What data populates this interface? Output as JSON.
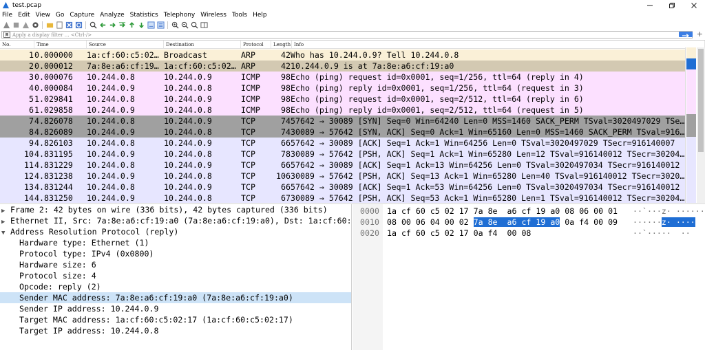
{
  "window": {
    "title": "test.pcap"
  },
  "menu": [
    "File",
    "Edit",
    "View",
    "Go",
    "Capture",
    "Analyze",
    "Statistics",
    "Telephony",
    "Wireless",
    "Tools",
    "Help"
  ],
  "filter": {
    "placeholder": "Apply a display filter … <Ctrl-/>"
  },
  "columns": [
    "No.",
    "Time",
    "Source",
    "Destination",
    "Protocol",
    "Length",
    "Info"
  ],
  "row_colors": {
    "arp": "#faf0d7",
    "icmp": "#fce0ff",
    "tcp_syn": "#a0a0a0",
    "tcp": "#e7e6ff",
    "selected": "#d3c9b2"
  },
  "packets": [
    {
      "no": "1",
      "time": "0.000000",
      "src": "1a:cf:60:c5:02…",
      "dst": "Broadcast",
      "proto": "ARP",
      "len": "42",
      "info": "Who has 10.244.0.9? Tell 10.244.0.8",
      "color": "arp"
    },
    {
      "no": "2",
      "time": "0.000012",
      "src": "7a:8e:a6:cf:19…",
      "dst": "1a:cf:60:c5:02…",
      "proto": "ARP",
      "len": "42",
      "info": "10.244.0.9 is at 7a:8e:a6:cf:19:a0",
      "color": "selected"
    },
    {
      "no": "3",
      "time": "0.000076",
      "src": "10.244.0.8",
      "dst": "10.244.0.9",
      "proto": "ICMP",
      "len": "98",
      "info": "Echo (ping) request  id=0x0001, seq=1/256, ttl=64 (reply in 4)",
      "color": "icmp"
    },
    {
      "no": "4",
      "time": "0.000084",
      "src": "10.244.0.9",
      "dst": "10.244.0.8",
      "proto": "ICMP",
      "len": "98",
      "info": "Echo (ping) reply    id=0x0001, seq=1/256, ttl=64 (request in 3)",
      "color": "icmp"
    },
    {
      "no": "5",
      "time": "1.029841",
      "src": "10.244.0.8",
      "dst": "10.244.0.9",
      "proto": "ICMP",
      "len": "98",
      "info": "Echo (ping) request  id=0x0001, seq=2/512, ttl=64 (reply in 6)",
      "color": "icmp"
    },
    {
      "no": "6",
      "time": "1.029858",
      "src": "10.244.0.9",
      "dst": "10.244.0.8",
      "proto": "ICMP",
      "len": "98",
      "info": "Echo (ping) reply    id=0x0001, seq=2/512, ttl=64 (request in 5)",
      "color": "icmp"
    },
    {
      "no": "7",
      "time": "4.826078",
      "src": "10.244.0.8",
      "dst": "10.244.0.9",
      "proto": "TCP",
      "len": "74",
      "info": "57642 → 30089 [SYN] Seq=0 Win=64240 Len=0 MSS=1460 SACK_PERM TSval=3020497029 TSe…",
      "color": "tcp_syn"
    },
    {
      "no": "8",
      "time": "4.826089",
      "src": "10.244.0.9",
      "dst": "10.244.0.8",
      "proto": "TCP",
      "len": "74",
      "info": "30089 → 57642 [SYN, ACK] Seq=0 Ack=1 Win=65160 Len=0 MSS=1460 SACK_PERM TSval=916…",
      "color": "tcp_syn"
    },
    {
      "no": "9",
      "time": "4.826103",
      "src": "10.244.0.8",
      "dst": "10.244.0.9",
      "proto": "TCP",
      "len": "66",
      "info": "57642 → 30089 [ACK] Seq=1 Ack=1 Win=64256 Len=0 TSval=3020497029 TSecr=916140007",
      "color": "tcp"
    },
    {
      "no": "10",
      "time": "4.831195",
      "src": "10.244.0.9",
      "dst": "10.244.0.8",
      "proto": "TCP",
      "len": "78",
      "info": "30089 → 57642 [PSH, ACK] Seq=1 Ack=1 Win=65280 Len=12 TSval=916140012 TSecr=30204…",
      "color": "tcp"
    },
    {
      "no": "11",
      "time": "4.831229",
      "src": "10.244.0.8",
      "dst": "10.244.0.9",
      "proto": "TCP",
      "len": "66",
      "info": "57642 → 30089 [ACK] Seq=1 Ack=13 Win=64256 Len=0 TSval=3020497034 TSecr=916140012",
      "color": "tcp"
    },
    {
      "no": "12",
      "time": "4.831238",
      "src": "10.244.0.9",
      "dst": "10.244.0.8",
      "proto": "TCP",
      "len": "106",
      "info": "30089 → 57642 [PSH, ACK] Seq=13 Ack=1 Win=65280 Len=40 TSval=916140012 TSecr=3020…",
      "color": "tcp"
    },
    {
      "no": "13",
      "time": "4.831244",
      "src": "10.244.0.8",
      "dst": "10.244.0.9",
      "proto": "TCP",
      "len": "66",
      "info": "57642 → 30089 [ACK] Seq=1 Ack=53 Win=64256 Len=0 TSval=3020497034 TSecr=916140012",
      "color": "tcp"
    },
    {
      "no": "14",
      "time": "4.831250",
      "src": "10.244.0.9",
      "dst": "10.244.0.8",
      "proto": "TCP",
      "len": "67",
      "info": "30089 → 57642 [PSH, ACK] Seq=53 Ack=1 Win=65280 Len=1 TSval=916140012 TSecr=30204…",
      "color": "tcp"
    }
  ],
  "details": {
    "frame": "Frame 2: 42 bytes on wire (336 bits), 42 bytes captured (336 bits)",
    "ethernet": "Ethernet II, Src: 7a:8e:a6:cf:19:a0 (7a:8e:a6:cf:19:a0), Dst: 1a:cf:60:c5",
    "arp": "Address Resolution Protocol (reply)",
    "arp_fields": [
      "Hardware type: Ethernet (1)",
      "Protocol type: IPv4 (0x0800)",
      "Hardware size: 6",
      "Protocol size: 4",
      "Opcode: reply (2)",
      "Sender MAC address: 7a:8e:a6:cf:19:a0 (7a:8e:a6:cf:19:a0)",
      "Sender IP address: 10.244.0.9",
      "Target MAC address: 1a:cf:60:c5:02:17 (1a:cf:60:c5:02:17)",
      "Target IP address: 10.244.0.8"
    ]
  },
  "bytes": [
    {
      "offset": "0000",
      "hex_a": "1a cf 60 c5 02 17 7a 8e  a6 cf 19 a0 08 06 00 01",
      "hex_hl": "",
      "hex_b": "",
      "ascii_a": "··`···z· ········",
      "ascii_hl": "",
      "ascii_b": ""
    },
    {
      "offset": "0010",
      "hex_a": "08 00 06 04 00 02 ",
      "hex_hl": "7a 8e  a6 cf 19 a0",
      "hex_b": " 0a f4 00 09",
      "ascii_a": "······",
      "ascii_hl": "z· ····",
      "ascii_b": ""
    },
    {
      "offset": "0020",
      "hex_a": "1a cf 60 c5 02 17 0a f4  00 08",
      "hex_hl": "",
      "hex_b": "",
      "ascii_a": "··`·····  ··",
      "ascii_hl": "",
      "ascii_b": ""
    }
  ]
}
